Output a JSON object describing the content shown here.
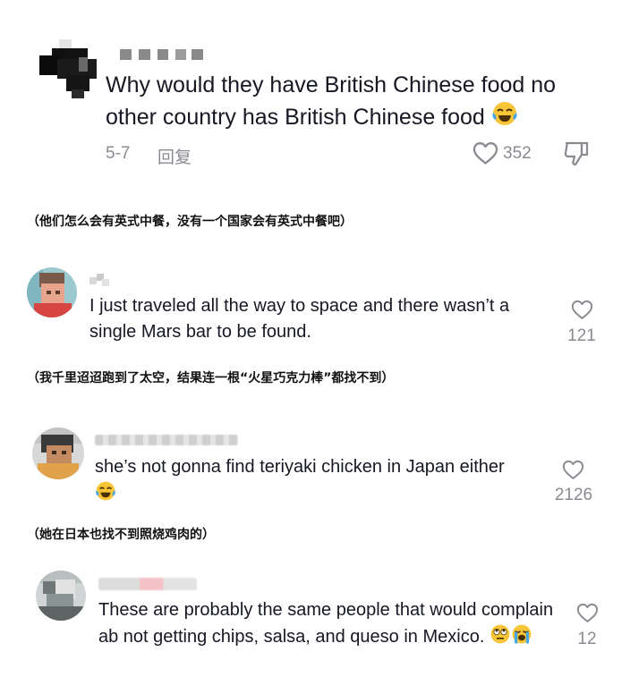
{
  "comments": [
    {
      "text": "Why would they have British Chinese food no other country has British Chinese food",
      "emoji": "😂",
      "date": "5-7",
      "reply_label": "回复",
      "likes": "352",
      "translation": "（他们怎么会有英式中餐，没有一个国家会有英式中餐吧）"
    },
    {
      "text": "I just traveled all the way to space and there wasn’t a single Mars bar to be found.",
      "likes": "121",
      "translation": "（我千里迢迢跑到了太空，结果连一根“火星巧克力棒”都找不到）"
    },
    {
      "text": "she’s not gonna find teriyaki chicken in Japan either",
      "emoji": "😂",
      "likes": "2126",
      "translation": "（她在日本也找不到照烧鸡肉的）"
    },
    {
      "text": "These are probably the same people that would complain ab not getting chips, salsa, and queso in Mexico.",
      "emoji": "🙄😭",
      "likes": "12"
    }
  ],
  "icons": {
    "like": "heart-outline-icon",
    "dislike": "thumbs-down-icon",
    "laugh": "face-with-tears-of-joy-emoji",
    "eyeroll": "face-with-rolling-eyes-emoji",
    "cry": "loudly-crying-face-emoji"
  },
  "colors": {
    "text": "#161823",
    "meta": "#8a8b91",
    "background": "#ffffff"
  }
}
